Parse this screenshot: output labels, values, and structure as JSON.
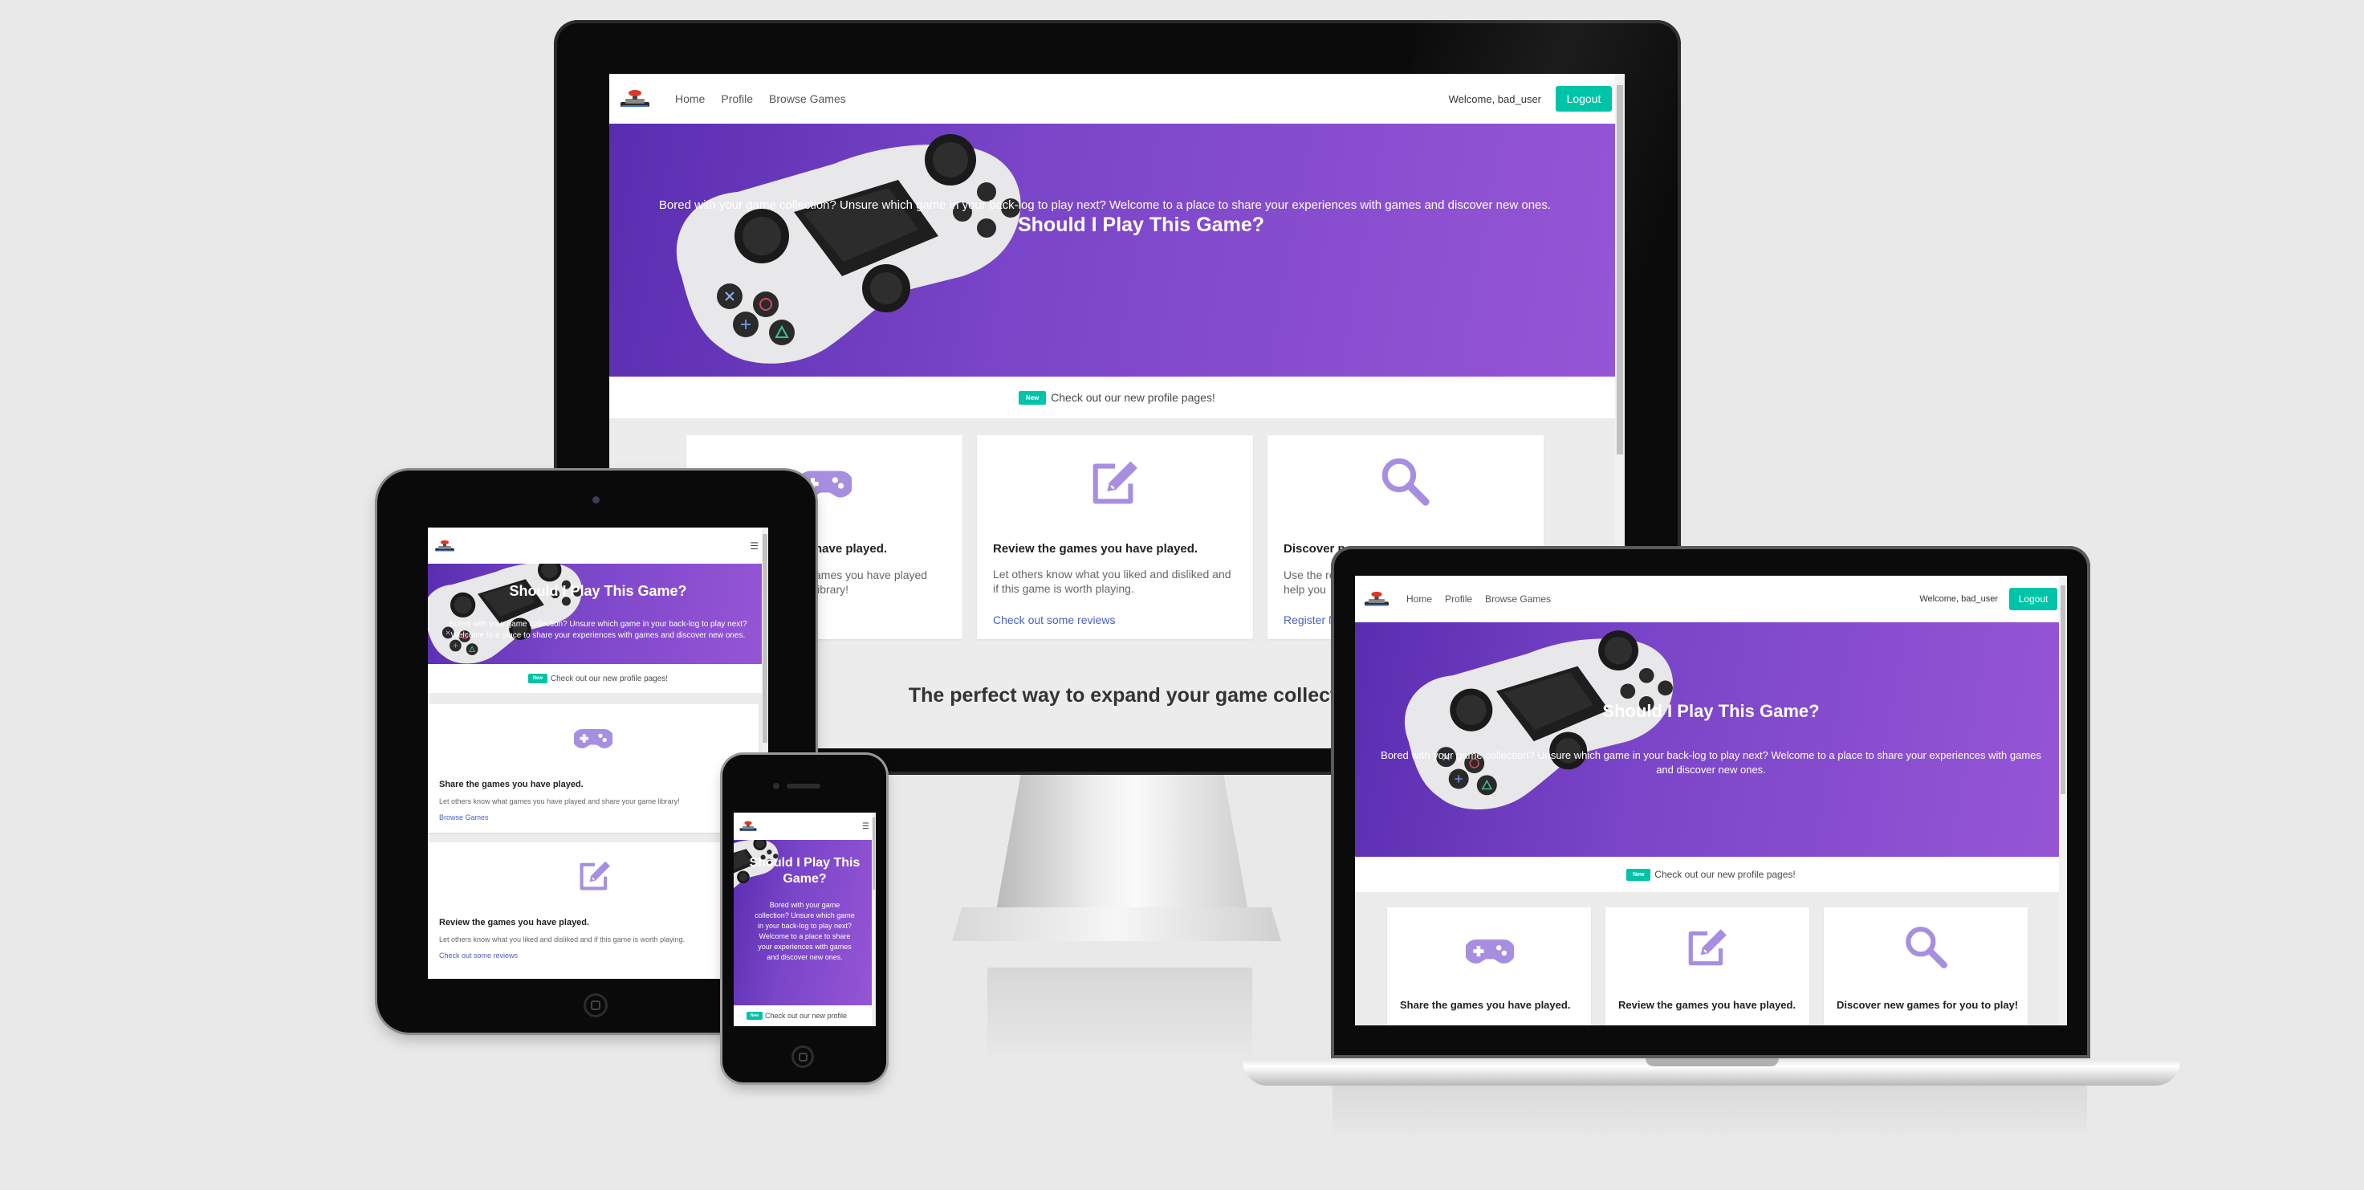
{
  "site": {
    "nav": {
      "home": "Home",
      "profile": "Profile",
      "browse": "Browse Games",
      "welcome": "Welcome, bad_user",
      "logout": "Logout"
    },
    "hero": {
      "title": "Should I Play This Game?",
      "subtitle": "Bored with your game collection? Unsure which game in your back-log to play next? Welcome to a place to share your experiences with games and discover new ones."
    },
    "news": {
      "tag": "New",
      "text": "Check out our new profile pages!"
    },
    "cards": [
      {
        "icon": "gamepad-icon",
        "title": "Share the games you have played.",
        "text": "Let others know what games you have played and share your game library!",
        "link": "Browse Games"
      },
      {
        "icon": "edit-icon",
        "title": "Review the games you have played.",
        "text": "Let others know what you liked and disliked and if this game is worth playing.",
        "link": "Check out some reviews"
      },
      {
        "icon": "search-icon",
        "title": "Discover new games for you to play!",
        "text": "Use the reviews and ratings to help you find your next game.",
        "link": "Register Now"
      }
    ],
    "tagline": "The perfect way to expand your game collection!"
  },
  "desktop_cropped": {
    "card1_title": "have played.",
    "card1_text_l1": "ames you have played",
    "card1_text_l2": "library!",
    "card3_title": "Discover n",
    "card3_title_tail": "u to play!",
    "card3_text_l1": "Use the re",
    "card3_text_l2": "help you",
    "card3_link": "Register N"
  },
  "phone_cropped": {
    "title_l1": "Should I Play This",
    "title_l2": "Game?",
    "sub_l1": "Bored with your game",
    "sub_l2": "collection? Unsure which game",
    "sub_l3": "in your back-log to play next?",
    "sub_l4": "Welcome to a place to share",
    "sub_l5": "your experiences with games",
    "sub_l6": "and discover new ones.",
    "news_text": "Check out our new profile"
  },
  "tablet_cropped": {
    "sub_l1": "Bored with your game collection? Unsure which game in your back-log to play next?",
    "sub_l2": "Welcome to a place to share your experiences with games and discover new ones."
  },
  "laptop_cropped": {
    "sub_l1": "Bored with your game collection? Unsure which game in your back-log to play next? Welcome to a place to share your experiences with games",
    "sub_l2": "and discover new ones."
  },
  "colors": {
    "accent": "#00c4a7",
    "hero_purple": "#7a45c8",
    "icon_purple": "#a78ee0",
    "link": "#485fc7"
  }
}
